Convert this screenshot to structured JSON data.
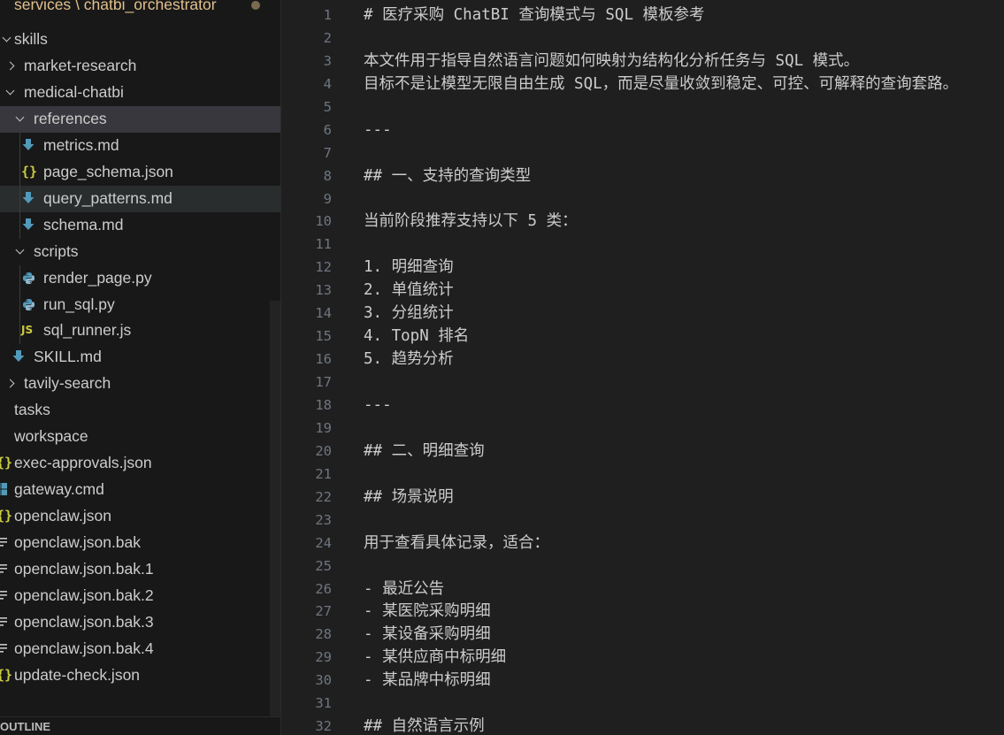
{
  "explorer": {
    "top_path": "services \\ chatbi_orchestrator",
    "outline_label": "OUTLINE",
    "tree": [
      {
        "label": "skills",
        "kind": "folder-open"
      },
      {
        "label": "market-research",
        "kind": "folder-closed"
      },
      {
        "label": "medical-chatbi",
        "kind": "folder-open"
      },
      {
        "label": "references",
        "kind": "folder-open"
      },
      {
        "label": "metrics.md",
        "kind": "md"
      },
      {
        "label": "page_schema.json",
        "kind": "json"
      },
      {
        "label": "query_patterns.md",
        "kind": "md"
      },
      {
        "label": "schema.md",
        "kind": "md"
      },
      {
        "label": "scripts",
        "kind": "folder-open"
      },
      {
        "label": "render_page.py",
        "kind": "py"
      },
      {
        "label": "run_sql.py",
        "kind": "py"
      },
      {
        "label": "sql_runner.js",
        "kind": "js"
      },
      {
        "label": "SKILL.md",
        "kind": "md"
      },
      {
        "label": "tavily-search",
        "kind": "folder-closed"
      },
      {
        "label": "tasks",
        "kind": "folder-closed"
      },
      {
        "label": "workspace",
        "kind": "folder-closed"
      },
      {
        "label": "exec-approvals.json",
        "kind": "json"
      },
      {
        "label": "gateway.cmd",
        "kind": "cmd"
      },
      {
        "label": "openclaw.json",
        "kind": "json"
      },
      {
        "label": "openclaw.json.bak",
        "kind": "txt"
      },
      {
        "label": "openclaw.json.bak.1",
        "kind": "txt"
      },
      {
        "label": "openclaw.json.bak.2",
        "kind": "txt"
      },
      {
        "label": "openclaw.json.bak.3",
        "kind": "txt"
      },
      {
        "label": "openclaw.json.bak.4",
        "kind": "txt"
      },
      {
        "label": "update-check.json",
        "kind": "json"
      }
    ],
    "icon_names": {
      "md": "markdown-icon",
      "json": "json-icon",
      "py": "python-icon",
      "js": "javascript-icon",
      "cmd": "windows-icon",
      "txt": "text-file-icon"
    },
    "colors": {
      "md_icon": "#519aba",
      "json_icon": "#cbcb41",
      "py_icon": "#519aba",
      "cmd_icon": "#519aba",
      "path_text": "#e2c08d"
    }
  },
  "editor": {
    "lines": [
      "# 医疗采购 ChatBI 查询模式与 SQL 模板参考",
      "",
      "本文件用于指导自然语言问题如何映射为结构化分析任务与 SQL 模式。",
      "目标不是让模型无限自由生成 SQL，而是尽量收敛到稳定、可控、可解释的查询套路。",
      "",
      "---",
      "",
      "## 一、支持的查询类型",
      "",
      "当前阶段推荐支持以下 5 类：",
      "",
      "1. 明细查询",
      "2. 单值统计",
      "3. 分组统计",
      "4. TopN 排名",
      "5. 趋势分析",
      "",
      "---",
      "",
      "## 二、明细查询",
      "",
      "## 场景说明",
      "",
      "用于查看具体记录，适合：",
      "",
      "- 最近公告",
      "- 某医院采购明细",
      "- 某设备采购明细",
      "- 某供应商中标明细",
      "- 某品牌中标明细",
      "",
      "## 自然语言示例"
    ]
  }
}
